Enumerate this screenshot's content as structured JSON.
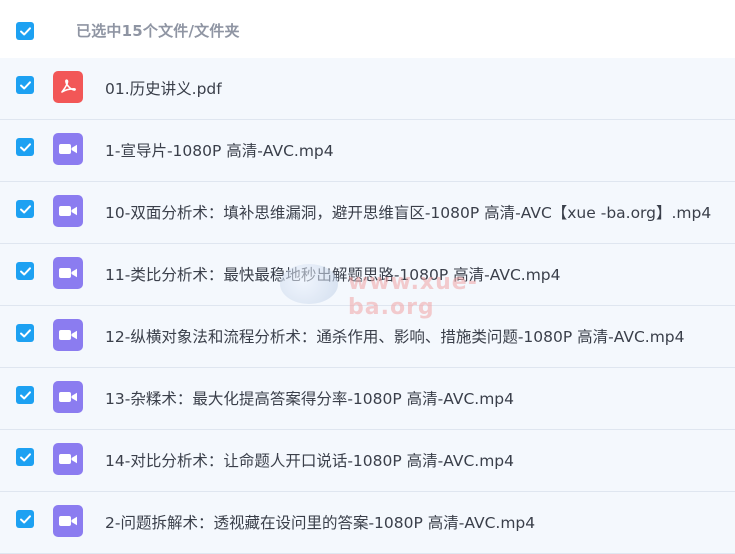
{
  "header": {
    "select_all_checked": true,
    "selection_label": "已选中15个文件/文件夹"
  },
  "files": [
    {
      "name": "01.历史讲义.pdf",
      "type": "pdf",
      "checked": true
    },
    {
      "name": "1-宣导片-1080P 高清-AVC.mp4",
      "type": "video",
      "checked": true
    },
    {
      "name": "10-双面分析术：填补思维漏洞，避开思维盲区-1080P 高清-AVC【xue -ba.org】.mp4",
      "type": "video",
      "checked": true
    },
    {
      "name": "11-类比分析术：最快最稳地秒出解题思路-1080P 高清-AVC.mp4",
      "type": "video",
      "checked": true
    },
    {
      "name": "12-纵横对象法和流程分析术：通杀作用、影响、措施类问题-1080P 高清-AVC.mp4",
      "type": "video",
      "checked": true
    },
    {
      "name": "13-杂糅术：最大化提高答案得分率-1080P 高清-AVC.mp4",
      "type": "video",
      "checked": true
    },
    {
      "name": "14-对比分析术：让命题人开口说话-1080P 高清-AVC.mp4",
      "type": "video",
      "checked": true
    },
    {
      "name": "2-问题拆解术：透视藏在设问里的答案-1080P 高清-AVC.mp4",
      "type": "video",
      "checked": true
    }
  ],
  "watermark": {
    "text": "www.xue-ba.org"
  },
  "colors": {
    "checkbox": "#1da1f2",
    "pdf_icon": "#f25757",
    "video_icon": "#8b7cf0",
    "row_bg": "#f4f8fd"
  }
}
